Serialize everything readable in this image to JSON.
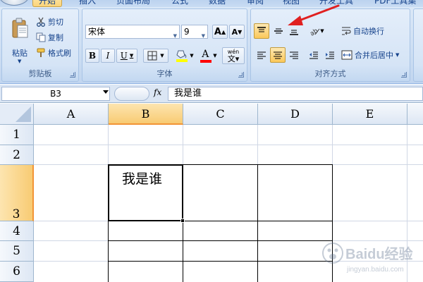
{
  "tabs": [
    {
      "label": "开始",
      "active": true
    },
    {
      "label": "插入"
    },
    {
      "label": "页面布局"
    },
    {
      "label": "公式"
    },
    {
      "label": "数据"
    },
    {
      "label": "审阅"
    },
    {
      "label": "视图"
    },
    {
      "label": "开发工具"
    },
    {
      "label": "PDF工具集"
    }
  ],
  "clipboard": {
    "paste_label": "粘贴",
    "cut_label": "剪切",
    "copy_label": "复制",
    "format_painter_label": "格式刷",
    "group_title": "剪贴板"
  },
  "font": {
    "font_name": "宋体",
    "font_size": "9",
    "grow_label": "A",
    "shrink_label": "A",
    "bold_label": "B",
    "italic_label": "I",
    "underline_label": "U",
    "font_color_label": "A",
    "phonetic_label": "wén",
    "group_title": "字体"
  },
  "alignment": {
    "wrap_text_label": "自动换行",
    "merge_center_label": "合并后居中",
    "group_title": "对齐方式",
    "active_vertical_align": "middle",
    "active_horizontal_align": "center"
  },
  "formula_bar": {
    "name_box": "B3",
    "fx_label": "fx",
    "content": "我是谁"
  },
  "grid": {
    "columns": [
      "A",
      "B",
      "C",
      "D",
      "E"
    ],
    "rows": [
      "1",
      "2",
      "3",
      "4",
      "5",
      "6"
    ],
    "selected_column": "B",
    "selected_row": "3",
    "cells": [
      {
        "ref": "B3",
        "value": "我是谁"
      }
    ]
  },
  "colors": {
    "selection_header": "#f8cb73",
    "font_color_bar": "#ff0000",
    "fill_color_bar": "#ffff00",
    "annotation_arrow": "#e02020"
  },
  "watermark": {
    "brand": "Baidu经验",
    "url": "jingyan.baidu.com"
  }
}
